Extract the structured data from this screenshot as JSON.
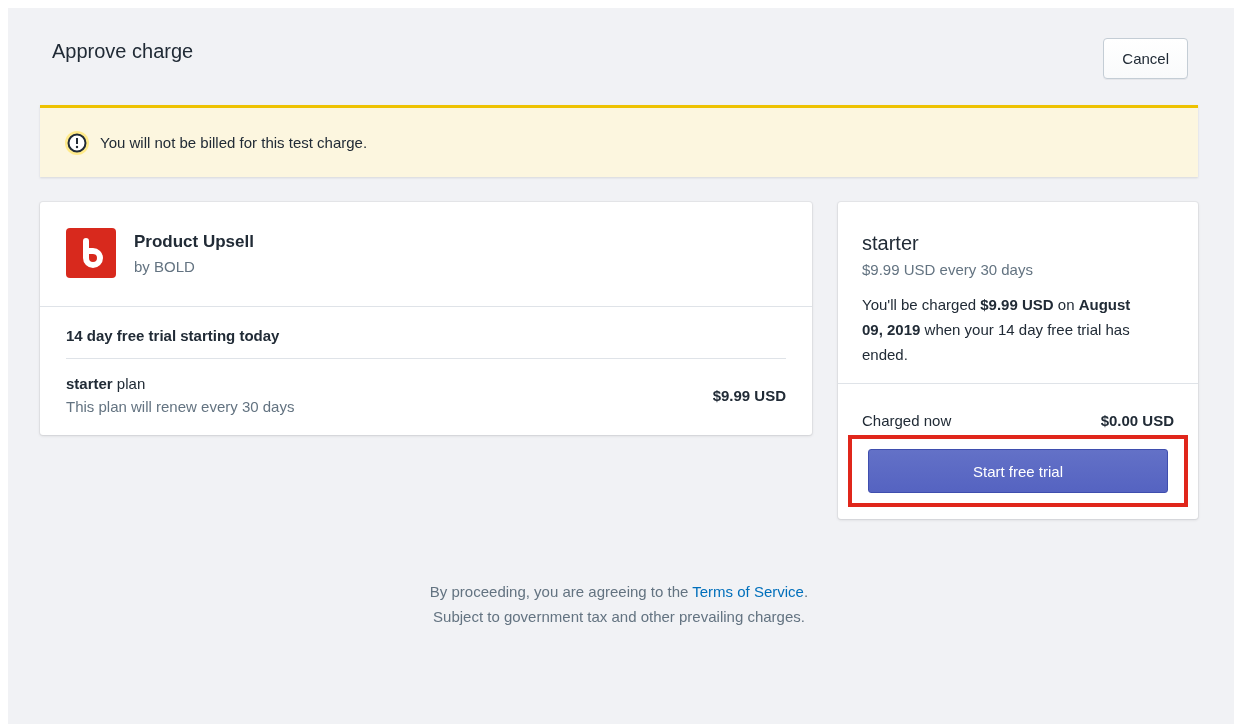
{
  "header": {
    "title": "Approve charge",
    "cancel_button": "Cancel"
  },
  "banner": {
    "kind": "warning",
    "text": "You will not be billed for this test charge."
  },
  "app": {
    "name": "Product Upsell",
    "developer": "by BOLD",
    "trial": "14 day free trial starting today",
    "plan_label": "**starter** plan",
    "plan_note": "This plan will renew every 30 days",
    "price": "$9.99 USD"
  },
  "summary": {
    "plan": "starter",
    "price_line": "$9.99 USD every 30 days",
    "notice": "You'll be charged **$9.99 USD** on **August 09, 2019** when your 14 day free trial has ended.",
    "charged_label": "Charged now",
    "charged_amount": "$0.00 USD",
    "action_button": "Start free trial",
    "highlighted": true
  },
  "footer": {
    "prefix": "By proceeding, you are agreeing to the ",
    "link": "Terms of Service",
    "suffix": ".",
    "note": "Subject to government tax and other prevailing charges."
  }
}
